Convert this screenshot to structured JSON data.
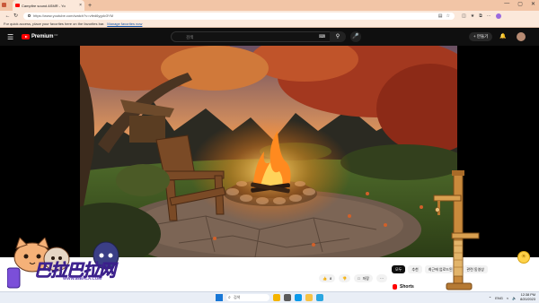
{
  "browser": {
    "tab_title": "Campfire sound ASMR - Yo",
    "tab_close": "×",
    "new_tab": "+",
    "url": "https://www.youtube.com/watch?v=vfed6ygdv3YM",
    "favorites_prompt": "For quick access, place your favorites here on the favorites bar.",
    "manage_favorites": "Manage favorites now",
    "window_controls": [
      "—",
      "▢",
      "✕"
    ]
  },
  "youtube": {
    "logo_text": "Premium",
    "logo_region": "KR",
    "search_placeholder": "검색",
    "create_label": "+ 만들기"
  },
  "video_actions": {
    "like_count": "8",
    "save_label": "저장",
    "more": "···"
  },
  "chips": [
    "모두",
    "추천",
    "최근에 업로드된 동",
    "관련 동영상"
  ],
  "shorts_label": "Shorts",
  "watermark": {
    "title": "巴拉巴拉网",
    "subtitle": "WWW.88BALA.COM"
  },
  "taskbar": {
    "search_placeholder": "검색",
    "lang": "ENG",
    "time": "12:38 PM",
    "date": "8/20/2023"
  },
  "colors": {
    "yt_red": "#ff0000",
    "chrome_tab_bg": "#f2c5a6",
    "watermark_purple": "#7b4fd9"
  }
}
